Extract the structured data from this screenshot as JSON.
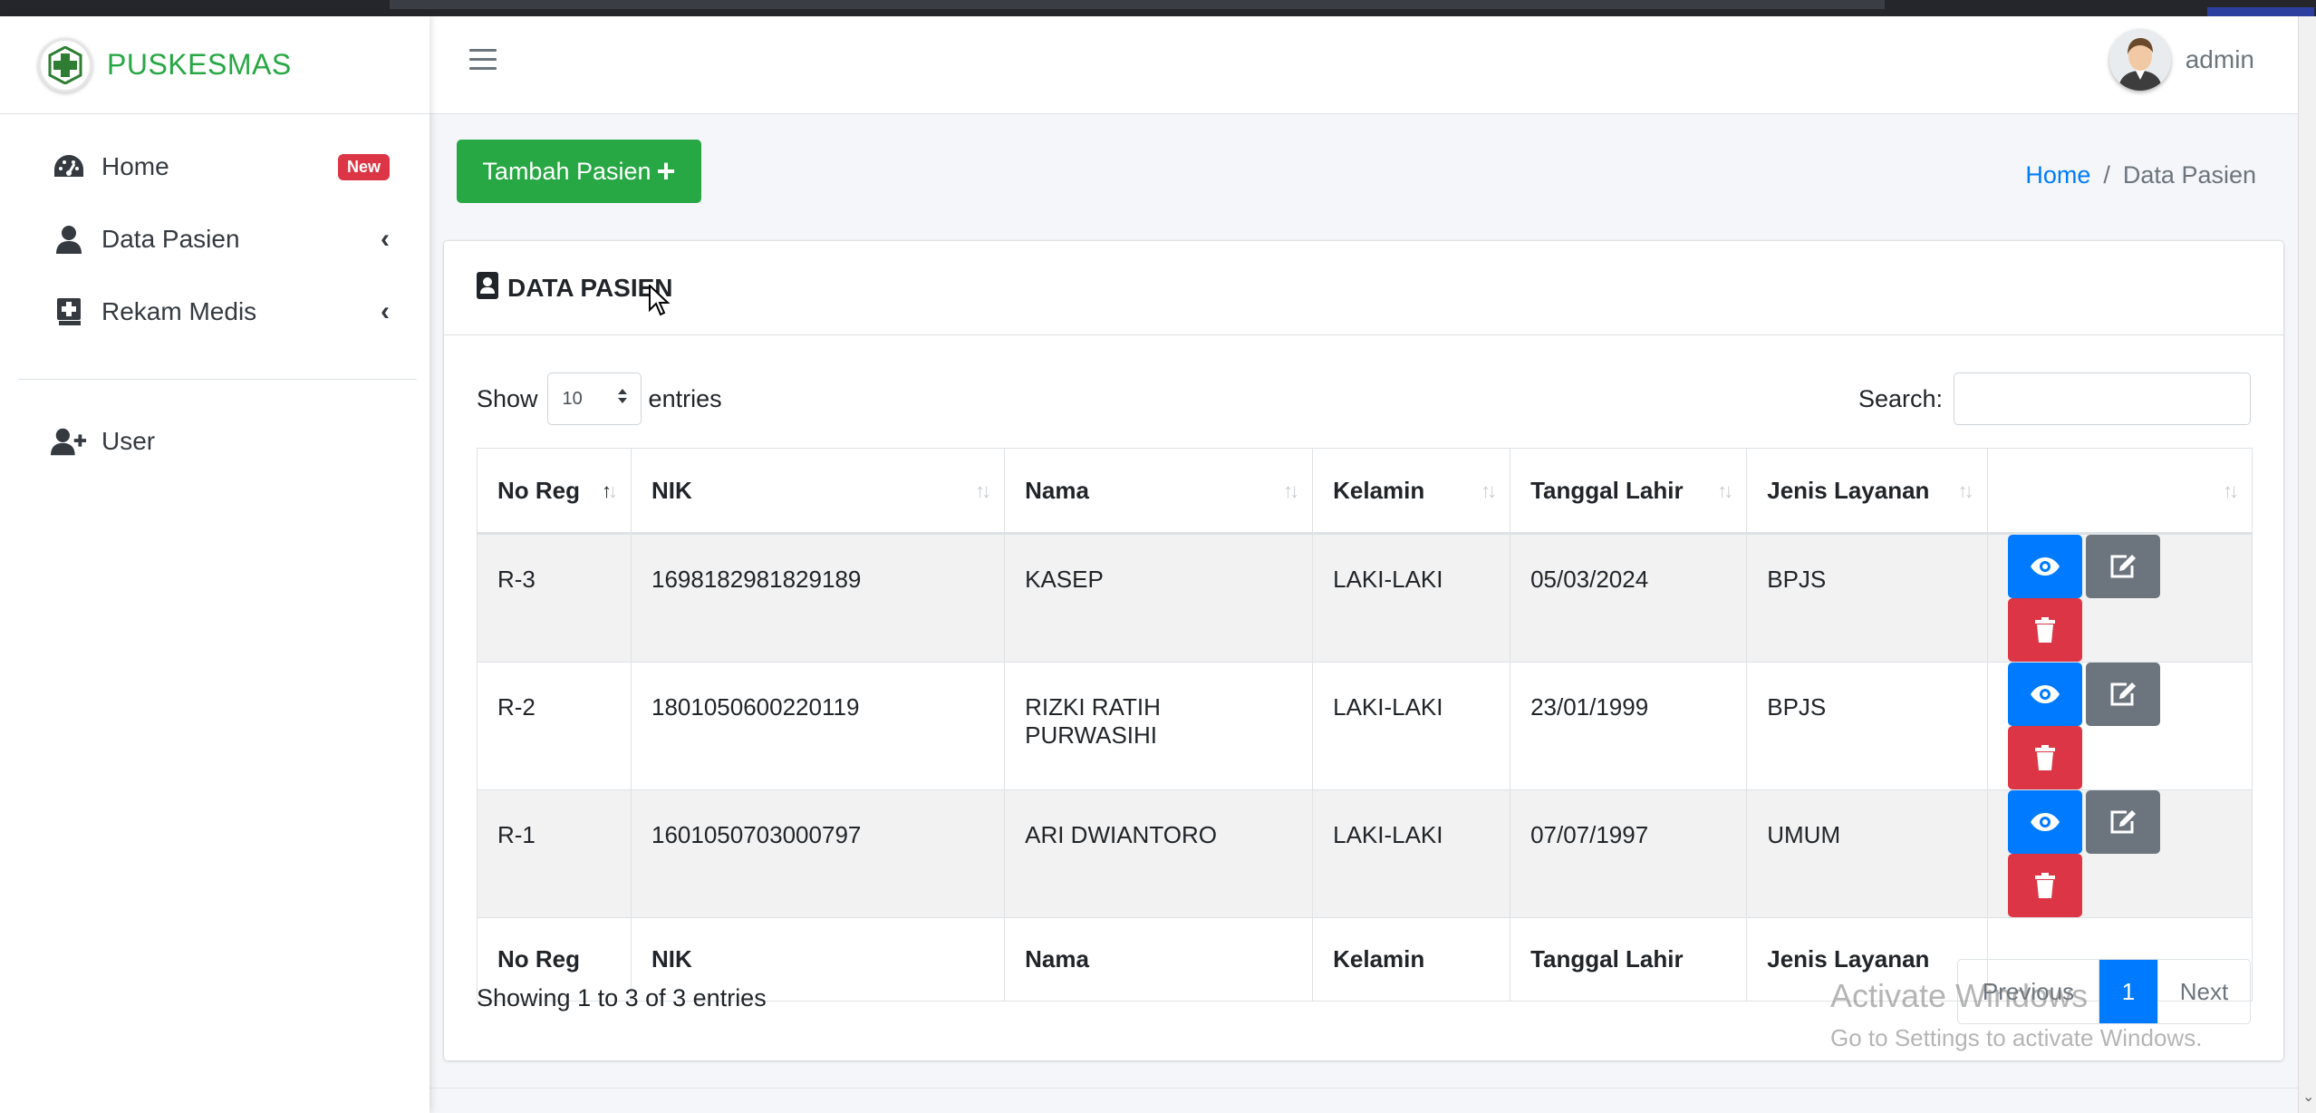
{
  "brand": {
    "name": "PUSKESMAS"
  },
  "sidebar": {
    "items": [
      {
        "label": "Home",
        "icon": "tachometer-icon",
        "badge": "New"
      },
      {
        "label": "Data Pasien",
        "icon": "user-icon",
        "chevron": "‹"
      },
      {
        "label": "Rekam Medis",
        "icon": "medical-book-icon",
        "chevron": "‹"
      },
      {
        "label": "User",
        "icon": "user-plus-icon"
      }
    ]
  },
  "header": {
    "username": "admin"
  },
  "toolbar": {
    "add_label": "Tambah Pasien",
    "add_icon": "+"
  },
  "breadcrumb": {
    "home": "Home",
    "sep": "/",
    "current": "Data Pasien"
  },
  "card": {
    "title": "DATA PASIEN"
  },
  "controls": {
    "show_label": "Show",
    "entries_value": "10",
    "entries_label": "entries",
    "search_label": "Search:",
    "search_value": ""
  },
  "table": {
    "headers": [
      "No Reg",
      "NIK",
      "Nama",
      "Kelamin",
      "Tanggal Lahir",
      "Jenis Layanan"
    ],
    "rows": [
      [
        "R-3",
        "1698182981829189",
        "KASEP",
        "LAKI-LAKI",
        "05/03/2024",
        "BPJS"
      ],
      [
        "R-2",
        "1801050600220119",
        "RIZKI RATIH PURWASIHI",
        "LAKI-LAKI",
        "23/01/1999",
        "BPJS"
      ],
      [
        "R-1",
        "1601050703000797",
        "ARI DWIANTORO",
        "LAKI-LAKI",
        "07/07/1997",
        "UMUM"
      ]
    ]
  },
  "pagination": {
    "info": "Showing 1 to 3 of 3 entries",
    "previous": "Previous",
    "current": "1",
    "next": "Next"
  },
  "watermark": {
    "line1": "Activate Windows",
    "line2": "Go to Settings to activate Windows."
  },
  "colors": {
    "primary": "#007bff",
    "success": "#28a745",
    "danger": "#dc3545",
    "secondary": "#6c757d"
  }
}
